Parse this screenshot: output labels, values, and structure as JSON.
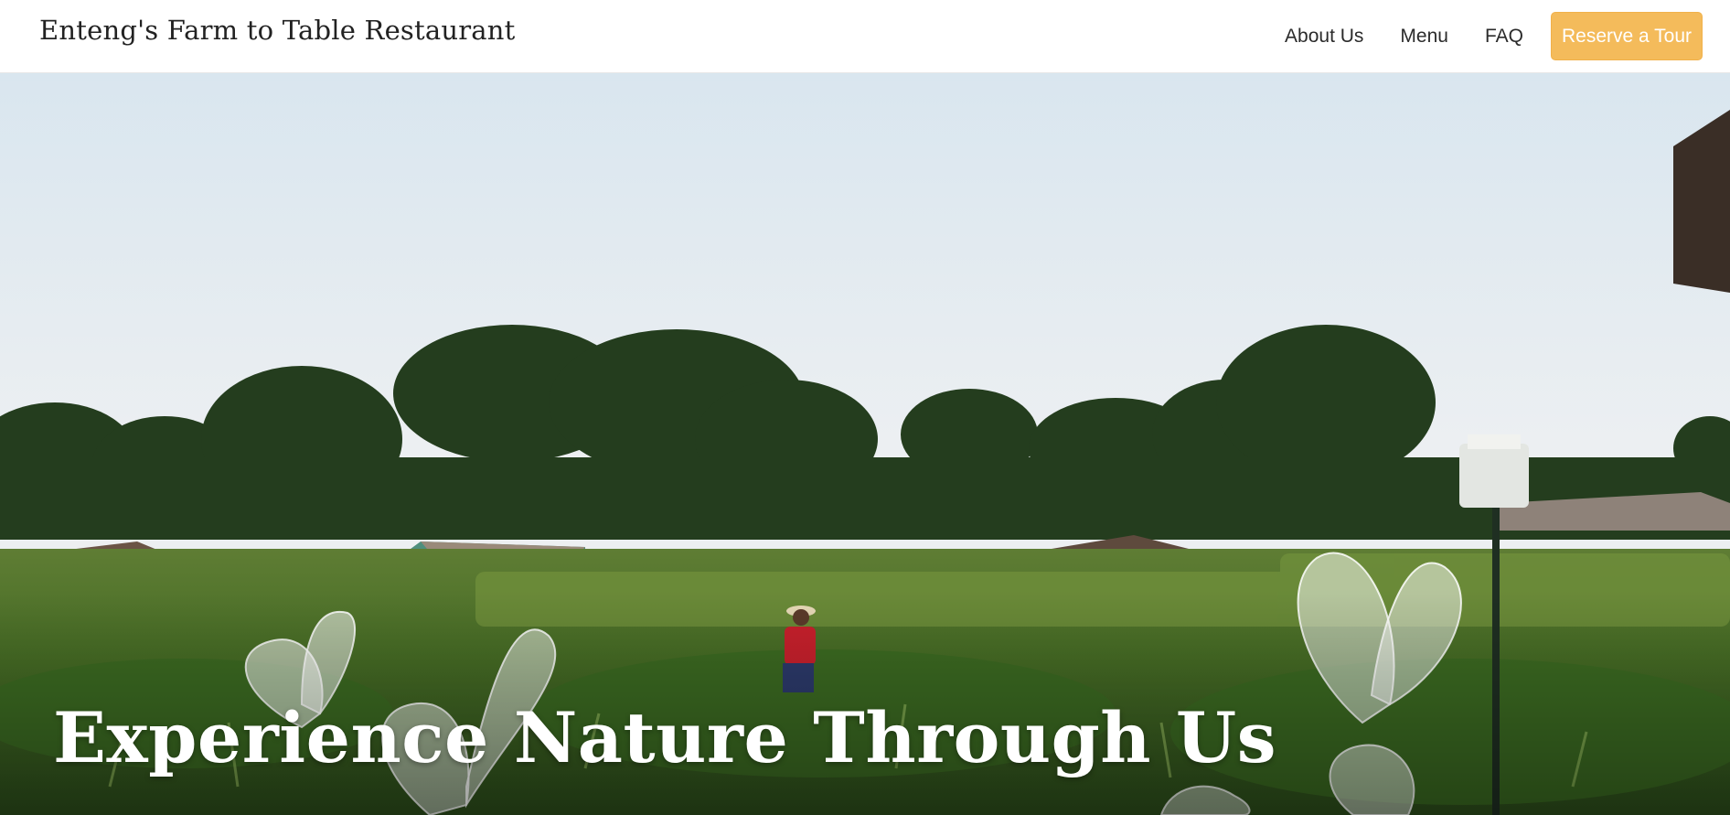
{
  "header": {
    "brand": "Enteng's Farm to Table Restaurant",
    "nav": [
      "About Us",
      "Menu",
      "FAQ"
    ],
    "cta_label": "Reserve a Tour"
  },
  "hero": {
    "title": "Experience Nature Through Us"
  },
  "colors": {
    "cta_background": "#f4bb5b",
    "sky_top": "#dde9f1",
    "sky_bottom": "#eeeff0",
    "foliage": "#2f5a22"
  },
  "icons": {
    "decor": [
      "butterfly-icon"
    ]
  }
}
